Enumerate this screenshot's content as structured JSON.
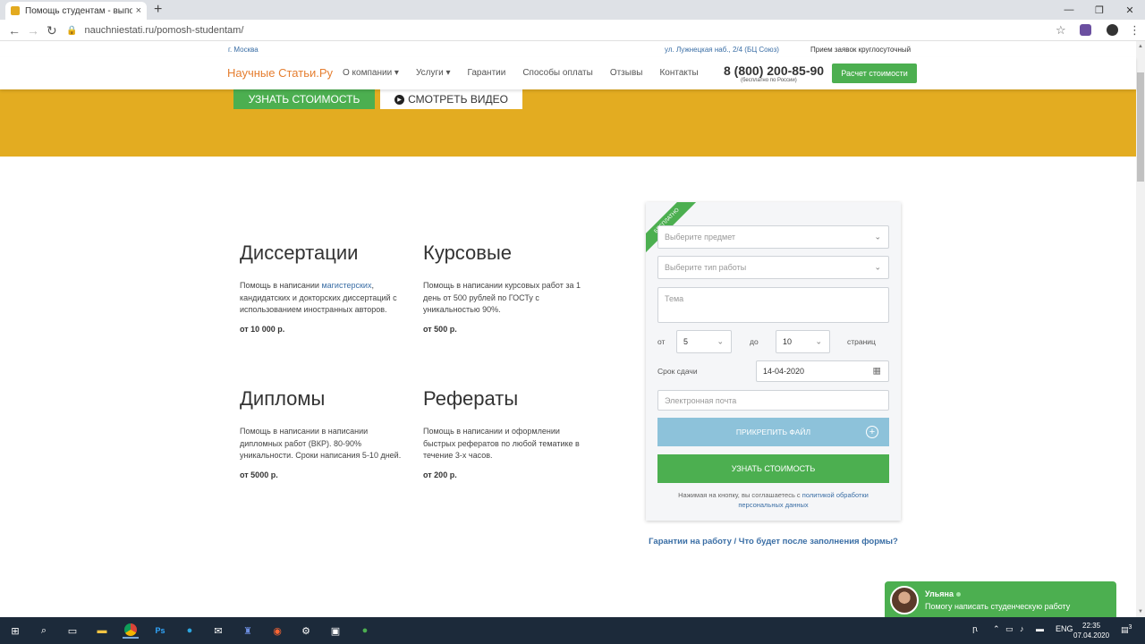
{
  "browser": {
    "tab_title": "Помощь студентам - выполнен",
    "new_tab": "+",
    "close_tab": "×",
    "url": "nauchniestati.ru/pomosh-studentam/",
    "window_controls": [
      "—",
      "❐",
      "✕"
    ]
  },
  "topinfo": {
    "city": "г. Москва",
    "address": "ул. Лужнецкая наб., 2/4 (БЦ Союз)",
    "hours": "Прием заявок круглосуточный"
  },
  "nav": {
    "logo": "Научные Статьи.Ру",
    "items": [
      "О компании ▾",
      "Услуги ▾",
      "Гарантии",
      "Способы оплаты",
      "Отзывы",
      "Контакты"
    ],
    "phone": "8 (800) 200-85-90",
    "phone_note": "(бесплатно по России)",
    "cta": "Расчет стоимости"
  },
  "hero": {
    "price_btn": "УЗНАТЬ СТОИМОСТЬ",
    "video_btn": "СМОТРЕТЬ ВИДЕО"
  },
  "services": [
    {
      "title": "Диссертации",
      "desc_before": "Помощь в написании ",
      "desc_link": "магистерских",
      "desc_after": ", кандидатских и докторских диссертаций с использованием иностранных авторов.",
      "price": "от 10 000 р."
    },
    {
      "title": "Курсовые",
      "desc": "Помощь в написании курсовых работ за 1 день от 500 рублей по ГОСТу с уникальностью 90%.",
      "price": "от 500 р."
    },
    {
      "title": "Дипломы",
      "desc": "Помощь в написании в написании дипломных работ (ВКР). 80-90% уникальности. Сроки написания 5-10 дней.",
      "price": "от 5000 р."
    },
    {
      "title": "Рефераты",
      "desc": "Помощь в написании и оформлении быстрых рефератов по любой тематике в течение 3-х часов.",
      "price": "от 200 р."
    }
  ],
  "form": {
    "ribbon": "БЕСПЛАТНО",
    "subject_placeholder": "Выберите предмет",
    "worktype_placeholder": "Выберите тип работы",
    "topic_placeholder": "Тема",
    "from_label": "от",
    "from_value": "5",
    "to_label": "до",
    "to_value": "10",
    "pages_label": "страниц",
    "deadline_label": "Срок сдачи",
    "deadline_value": "14-04-2020",
    "email_placeholder": "Электронная почта",
    "attach_label": "ПРИКРЕПИТЬ ФАЙЛ",
    "submit_label": "УЗНАТЬ СТОИМОСТЬ",
    "consent_text": "Нажимая на кнопку, вы соглашаетесь с ",
    "consent_link": "политикой обработки персональных данных"
  },
  "guarantee_text": "Гарантии на работу / Что будет после заполнения формы?",
  "chat": {
    "name": "Ульяна",
    "message": "Помогу написать студенческую работу"
  },
  "taskbar": {
    "lang": "ENG",
    "time": "22:35",
    "date": "07.04.2020",
    "notifications": "3"
  },
  "colors": {
    "accent_green": "#4caf50",
    "hero_yellow": "#e3ac21",
    "logo_orange": "#e57e30",
    "link_blue": "#3a6ea5",
    "attach_blue": "#8dc2da"
  }
}
